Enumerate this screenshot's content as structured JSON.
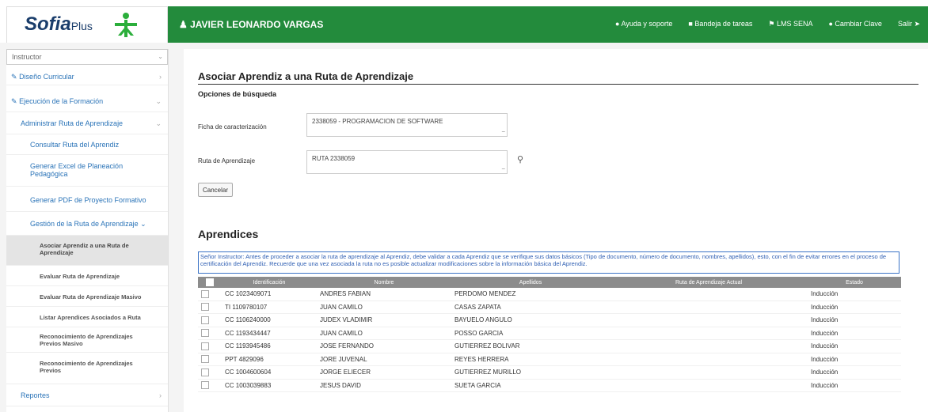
{
  "header": {
    "logo_text": "Sofia",
    "logo_plus": "Plus",
    "user_name": "JAVIER LEONARDO VARGAS",
    "nav": [
      "Ayuda y soporte",
      "Bandeja de tareas",
      "LMS SENA",
      "Cambiar Clave",
      "Salir"
    ]
  },
  "sidebar": {
    "role": "Instructor",
    "items": [
      {
        "label": "Diseño Curricular"
      },
      {
        "label": "Ejecución de la Formación"
      },
      {
        "label": "Administrar Ruta de Aprendizaje"
      },
      {
        "label": "Consultar Ruta del Aprendiz"
      },
      {
        "label": "Generar Excel de Planeación Pedagógica"
      },
      {
        "label": "Generar PDF de Proyecto Formativo"
      },
      {
        "label": "Gestión de la Ruta de Aprendizaje"
      },
      {
        "label": "Asociar Aprendiz a una Ruta de Aprendizaje"
      },
      {
        "label": "Evaluar Ruta de Aprendizaje"
      },
      {
        "label": "Evaluar Ruta de Aprendizaje Masivo"
      },
      {
        "label": "Listar Aprendices Asociados a Ruta"
      },
      {
        "label": "Reconocimiento de Aprendizajes Previos Masivo"
      },
      {
        "label": "Reconocimiento de Aprendizajes Previos"
      },
      {
        "label": "Reportes"
      }
    ]
  },
  "main": {
    "title": "Asociar Aprendiz a una Ruta de Aprendizaje",
    "search_subtitle": "Opciones de búsqueda",
    "ficha_label": "Ficha de caracterización",
    "ficha_value": "2338059 - PROGRAMACION DE SOFTWARE",
    "ruta_label": "Ruta de Aprendizaje",
    "ruta_value": "RUTA 2338059",
    "cancel_label": "Cancelar",
    "section_title": "Aprendices",
    "notice": "Señor Instructor: Antes de proceder a asociar la ruta de aprendizaje al Aprendiz, debe validar a cada Aprendiz que se verifique sus datos básicos (Tipo de documento, número de documento, nombres, apellidos), esto, con el fin de evitar errores en el proceso de certificación del Aprendiz. Recuerde que una vez asociada la ruta no es posible actualizar modificaciones sobre la información básica del Aprendiz.",
    "table": {
      "headers": [
        "Identificación",
        "Nombre",
        "Apellidos",
        "Ruta de Aprendizaje Actual",
        "Estado"
      ],
      "rows": [
        {
          "id": "CC 1023409071",
          "nombre": "ANDRES FABIAN",
          "apellidos": "PERDOMO MENDEZ",
          "ruta": "",
          "estado": "Inducción"
        },
        {
          "id": "TI 1109780107",
          "nombre": "JUAN CAMILO",
          "apellidos": "CASAS ZAPATA",
          "ruta": "",
          "estado": "Inducción"
        },
        {
          "id": "CC 1106240000",
          "nombre": "JUDEX VLADIMIR",
          "apellidos": "BAYUELO ANGULO",
          "ruta": "",
          "estado": "Inducción"
        },
        {
          "id": "CC 1193434447",
          "nombre": "JUAN CAMILO",
          "apellidos": "POSSO GARCIA",
          "ruta": "",
          "estado": "Inducción"
        },
        {
          "id": "CC 1193945486",
          "nombre": "JOSE FERNANDO",
          "apellidos": "GUTIERREZ BOLIVAR",
          "ruta": "",
          "estado": "Inducción"
        },
        {
          "id": "PPT 4829096",
          "nombre": "JORE JUVENAL",
          "apellidos": "REYES HERRERA",
          "ruta": "",
          "estado": "Inducción"
        },
        {
          "id": "CC 1004600604",
          "nombre": "JORGE ELIECER",
          "apellidos": "GUTIERREZ MURILLO",
          "ruta": "",
          "estado": "Inducción"
        },
        {
          "id": "CC 1003039883",
          "nombre": "JESUS DAVID",
          "apellidos": "SUETA GARCIA",
          "ruta": "",
          "estado": "Inducción"
        }
      ]
    }
  }
}
